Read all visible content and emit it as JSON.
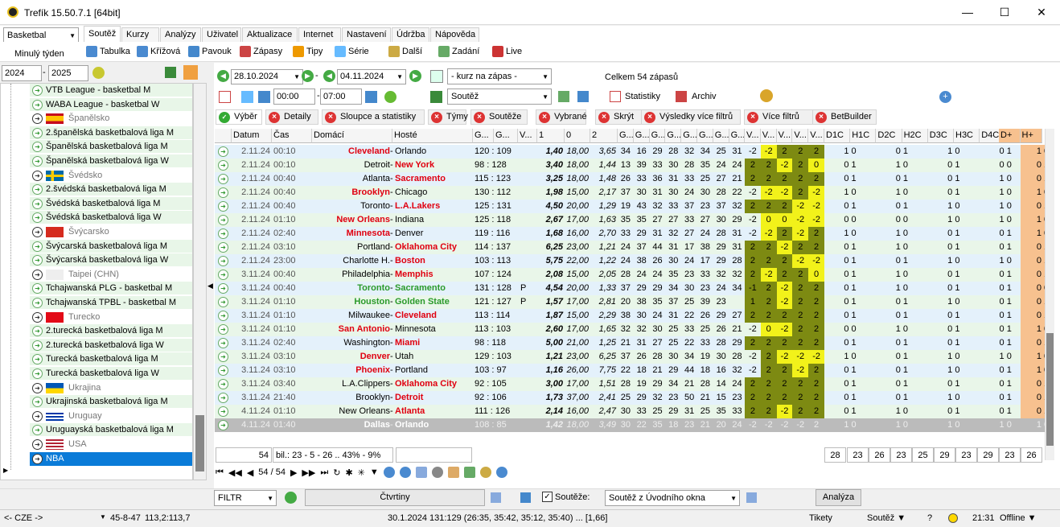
{
  "title": "Trefík 15.50.7.1 [64bit]",
  "sport": "Basketbal",
  "menu_tabs": [
    "Soutěž",
    "Kurzy",
    "Analýzy",
    "Uživatel",
    "Aktualizace",
    "Internet",
    "Nastavení",
    "Údržba",
    "Nápověda"
  ],
  "period": "Minulý týden",
  "toolbar": [
    "Tabulka",
    "Křížová",
    "Pavouk",
    "Zápasy",
    "Tipy",
    "Série",
    "Další",
    "Zadání",
    "Live"
  ],
  "year_from": "2024",
  "year_to": "2025",
  "tree": [
    {
      "t": "league",
      "label": "VTB League - basketbal M"
    },
    {
      "t": "league",
      "label": "WABA League - basketbal W"
    },
    {
      "t": "country",
      "label": "Španělsko",
      "flag": "es"
    },
    {
      "t": "league",
      "label": "2.španělská basketbalová liga M"
    },
    {
      "t": "league",
      "label": "Španělská basketbalová liga M"
    },
    {
      "t": "league",
      "label": "Španělská basketbalová liga W"
    },
    {
      "t": "country",
      "label": "Švédsko",
      "flag": "se"
    },
    {
      "t": "league",
      "label": "2.švédská basketbalová liga M"
    },
    {
      "t": "league",
      "label": "Švédská basketbalová liga M"
    },
    {
      "t": "league",
      "label": "Švédská basketbalová liga W"
    },
    {
      "t": "country",
      "label": "Švýcarsko",
      "flag": "ch"
    },
    {
      "t": "league",
      "label": "Švýcarská basketbalová liga M"
    },
    {
      "t": "league",
      "label": "Švýcarská basketbalová liga W"
    },
    {
      "t": "country",
      "label": "Taipei (CHN)",
      "flag": "tw"
    },
    {
      "t": "league",
      "label": "Tchajwanská PLG - basketbal M"
    },
    {
      "t": "league",
      "label": "Tchajwanská TPBL - basketbal M"
    },
    {
      "t": "country",
      "label": "Turecko",
      "flag": "tr"
    },
    {
      "t": "league",
      "label": "2.turecká basketbalová liga M"
    },
    {
      "t": "league",
      "label": "2.turecká basketbalová liga W"
    },
    {
      "t": "league",
      "label": "Turecká basketbalová liga M"
    },
    {
      "t": "league",
      "label": "Turecká basketbalová liga W"
    },
    {
      "t": "country",
      "label": "Ukrajina",
      "flag": "ua"
    },
    {
      "t": "league",
      "label": "Ukrajinská basketbalová liga M"
    },
    {
      "t": "country",
      "label": "Uruguay",
      "flag": "uy"
    },
    {
      "t": "league",
      "label": "Uruguayská basketbalová liga M"
    },
    {
      "t": "country",
      "label": "USA",
      "flag": "us"
    },
    {
      "t": "sel",
      "label": "NBA"
    }
  ],
  "date_from": "28.10.2024",
  "date_to": "04.11.2024",
  "odds_filter": "- kurz na zápas -",
  "competition_filter": "Soutěž",
  "summary": "Celkem 54 zápasů",
  "time_from": "00:00",
  "time_to": "07:00",
  "stats_label": "Statistiky",
  "archive_label": "Archiv",
  "filter_tabs": [
    "Výběr",
    "Detaily",
    "Sloupce a statistiky",
    "Týmy",
    "Soutěže",
    "Vybrané",
    "Skrýt",
    "Výsledky více filtrů",
    "Více filtrů",
    "BetBuilder"
  ],
  "columns": [
    "Datum",
    "Čas",
    "Domácí",
    "Hosté",
    "G...",
    "G...",
    "V...",
    "1",
    "0",
    "2",
    "G...",
    "G...",
    "G...",
    "G...",
    "G...",
    "G...",
    "G...",
    "G...",
    "V...",
    "V...",
    "V...",
    "V...",
    "V...",
    "D1C",
    "H1C",
    "D2C",
    "H2C",
    "D3C",
    "H3C",
    "D4C",
    "H4C",
    "D+",
    "H+"
  ],
  "rows": [
    {
      "d": "2.11.24",
      "t": "00:10",
      "h": "Cleveland",
      "a": "Orlando",
      "w": "h",
      "s": "120 : 109",
      "p": "",
      "o1": "1,40",
      "o0": "18,00",
      "o2": "3,65",
      "q": [
        "34",
        "16",
        "29",
        "28",
        "32",
        "34",
        "25",
        "31"
      ],
      "v": [
        "-2",
        "-2",
        "2",
        "2",
        "2"
      ],
      "qc": [
        "1 0",
        "0 1",
        "1 0",
        "0 1"
      ],
      "dp": "1 0"
    },
    {
      "d": "2.11.24",
      "t": "00:10",
      "h": "Detroit",
      "a": "New York",
      "w": "a",
      "s": "98 : 128",
      "p": "",
      "o1": "3,40",
      "o0": "18,00",
      "o2": "1,44",
      "q": [
        "13",
        "39",
        "33",
        "30",
        "28",
        "35",
        "24",
        "24"
      ],
      "v": [
        "2",
        "2",
        "-2",
        "2",
        "0"
      ],
      "qc": [
        "0 1",
        "1 0",
        "0 1",
        "0 0"
      ],
      "dp": "0 1"
    },
    {
      "d": "2.11.24",
      "t": "00:40",
      "h": "Atlanta",
      "a": "Sacramento",
      "w": "a",
      "s": "115 : 123",
      "p": "",
      "o1": "3,25",
      "o0": "18,00",
      "o2": "1,48",
      "q": [
        "26",
        "33",
        "36",
        "31",
        "33",
        "25",
        "27",
        "21"
      ],
      "v": [
        "2",
        "2",
        "2",
        "2",
        "2"
      ],
      "qc": [
        "0 1",
        "0 1",
        "0 1",
        "1 0"
      ],
      "dp": "0 1"
    },
    {
      "d": "2.11.24",
      "t": "00:40",
      "h": "Brooklyn",
      "a": "Chicago",
      "w": "h",
      "s": "130 : 112",
      "p": "",
      "o1": "1,98",
      "o0": "15,00",
      "o2": "2,17",
      "q": [
        "37",
        "30",
        "31",
        "30",
        "24",
        "30",
        "28",
        "22"
      ],
      "v": [
        "-2",
        "-2",
        "-2",
        "2",
        "-2"
      ],
      "qc": [
        "1 0",
        "1 0",
        "0 1",
        "1 0"
      ],
      "dp": "1 0"
    },
    {
      "d": "2.11.24",
      "t": "00:40",
      "h": "Toronto",
      "a": "L.A.Lakers",
      "w": "a",
      "s": "125 : 131",
      "p": "",
      "o1": "4,50",
      "o0": "20,00",
      "o2": "1,29",
      "q": [
        "19",
        "43",
        "32",
        "33",
        "37",
        "23",
        "37",
        "32"
      ],
      "v": [
        "2",
        "2",
        "2",
        "-2",
        "-2"
      ],
      "qc": [
        "0 1",
        "0 1",
        "1 0",
        "1 0"
      ],
      "dp": "0 1"
    },
    {
      "d": "2.11.24",
      "t": "01:10",
      "h": "New Orleans",
      "a": "Indiana",
      "w": "h",
      "s": "125 : 118",
      "p": "",
      "o1": "2,67",
      "o0": "17,00",
      "o2": "1,63",
      "q": [
        "35",
        "35",
        "27",
        "27",
        "33",
        "27",
        "30",
        "29"
      ],
      "v": [
        "-2",
        "0",
        "0",
        "-2",
        "-2"
      ],
      "qc": [
        "0 0",
        "0 0",
        "1 0",
        "1 0"
      ],
      "dp": "1 0"
    },
    {
      "d": "2.11.24",
      "t": "02:40",
      "h": "Minnesota",
      "a": "Denver",
      "w": "h",
      "s": "119 : 116",
      "p": "",
      "o1": "1,68",
      "o0": "16,00",
      "o2": "2,70",
      "q": [
        "33",
        "29",
        "31",
        "32",
        "27",
        "24",
        "28",
        "31"
      ],
      "v": [
        "-2",
        "-2",
        "2",
        "-2",
        "2"
      ],
      "qc": [
        "1 0",
        "1 0",
        "0 1",
        "0 1"
      ],
      "dp": "1 0"
    },
    {
      "d": "2.11.24",
      "t": "03:10",
      "h": "Portland",
      "a": "Oklahoma City",
      "w": "a",
      "s": "114 : 137",
      "p": "",
      "o1": "6,25",
      "o0": "23,00",
      "o2": "1,21",
      "q": [
        "24",
        "37",
        "44",
        "31",
        "17",
        "38",
        "29",
        "31"
      ],
      "v": [
        "2",
        "2",
        "-2",
        "2",
        "2"
      ],
      "qc": [
        "0 1",
        "1 0",
        "0 1",
        "0 1"
      ],
      "dp": "0 1"
    },
    {
      "d": "2.11.24",
      "t": "23:00",
      "h": "Charlotte H.",
      "a": "Boston",
      "w": "a",
      "s": "103 : 113",
      "p": "",
      "o1": "5,75",
      "o0": "22,00",
      "o2": "1,22",
      "q": [
        "24",
        "38",
        "26",
        "30",
        "24",
        "17",
        "29",
        "28"
      ],
      "v": [
        "2",
        "2",
        "2",
        "-2",
        "-2"
      ],
      "qc": [
        "0 1",
        "0 1",
        "1 0",
        "1 0"
      ],
      "dp": "0 1"
    },
    {
      "d": "3.11.24",
      "t": "00:40",
      "h": "Philadelphia",
      "a": "Memphis",
      "w": "a",
      "s": "107 : 124",
      "p": "",
      "o1": "2,08",
      "o0": "15,00",
      "o2": "2,05",
      "q": [
        "28",
        "24",
        "24",
        "35",
        "23",
        "33",
        "32",
        "32"
      ],
      "v": [
        "2",
        "-2",
        "2",
        "2",
        "0"
      ],
      "qc": [
        "0 1",
        "1 0",
        "0 1",
        "0 1"
      ],
      "dp": "0 1"
    },
    {
      "d": "3.11.24",
      "t": "00:40",
      "h": "Toronto",
      "a": "Sacramento",
      "w": "g",
      "s": "131 : 128",
      "p": "P",
      "o1": "4,54",
      "o0": "20,00",
      "o2": "1,33",
      "q": [
        "37",
        "29",
        "29",
        "34",
        "30",
        "23",
        "24",
        "34"
      ],
      "v": [
        "-1",
        "2",
        "-2",
        "2",
        "2"
      ],
      "qc": [
        "0 1",
        "1 0",
        "0 1",
        "0 1"
      ],
      "dp": "0 0"
    },
    {
      "d": "3.11.24",
      "t": "01:10",
      "h": "Houston",
      "a": "Golden State",
      "w": "g",
      "s": "121 : 127",
      "p": "P",
      "o1": "1,57",
      "o0": "17,00",
      "o2": "2,81",
      "q": [
        "20",
        "38",
        "35",
        "37",
        "25",
        "39",
        "23"
      ],
      "v": [
        "1",
        "2",
        "-2",
        "2",
        "2"
      ],
      "qc": [
        "0 1",
        "0 1",
        "1 0",
        "0 1"
      ],
      "dp": "0 1"
    },
    {
      "d": "3.11.24",
      "t": "01:10",
      "h": "Milwaukee",
      "a": "Cleveland",
      "w": "a",
      "s": "113 : 114",
      "p": "",
      "o1": "1,87",
      "o0": "15,00",
      "o2": "2,29",
      "q": [
        "38",
        "30",
        "24",
        "31",
        "22",
        "26",
        "29",
        "27"
      ],
      "v": [
        "2",
        "2",
        "2",
        "2",
        "2"
      ],
      "qc": [
        "0 1",
        "0 1",
        "0 1",
        "0 1"
      ],
      "dp": "0 1"
    },
    {
      "d": "3.11.24",
      "t": "01:10",
      "h": "San Antonio",
      "a": "Minnesota",
      "w": "h",
      "s": "113 : 103",
      "p": "",
      "o1": "2,60",
      "o0": "17,00",
      "o2": "1,65",
      "q": [
        "32",
        "32",
        "30",
        "25",
        "33",
        "25",
        "26",
        "21"
      ],
      "v": [
        "-2",
        "0",
        "-2",
        "2",
        "2"
      ],
      "qc": [
        "0 0",
        "1 0",
        "0 1",
        "0 1"
      ],
      "dp": "1 0"
    },
    {
      "d": "3.11.24",
      "t": "02:40",
      "h": "Washington",
      "a": "Miami",
      "w": "a",
      "s": "98 : 118",
      "p": "",
      "o1": "5,00",
      "o0": "21,00",
      "o2": "1,25",
      "q": [
        "21",
        "31",
        "27",
        "25",
        "22",
        "33",
        "28",
        "29"
      ],
      "v": [
        "2",
        "2",
        "2",
        "2",
        "2"
      ],
      "qc": [
        "0 1",
        "0 1",
        "0 1",
        "0 1"
      ],
      "dp": "0 1"
    },
    {
      "d": "3.11.24",
      "t": "03:10",
      "h": "Denver",
      "a": "Utah",
      "w": "h",
      "s": "129 : 103",
      "p": "",
      "o1": "1,21",
      "o0": "23,00",
      "o2": "6,25",
      "q": [
        "37",
        "26",
        "28",
        "30",
        "34",
        "19",
        "30",
        "28"
      ],
      "v": [
        "-2",
        "2",
        "-2",
        "-2",
        "-2"
      ],
      "qc": [
        "1 0",
        "0 1",
        "1 0",
        "1 0"
      ],
      "dp": "1 0"
    },
    {
      "d": "3.11.24",
      "t": "03:10",
      "h": "Phoenix",
      "a": "Portland",
      "w": "h",
      "s": "103 : 97",
      "p": "",
      "o1": "1,16",
      "o0": "26,00",
      "o2": "7,75",
      "q": [
        "22",
        "18",
        "21",
        "29",
        "44",
        "18",
        "16",
        "32"
      ],
      "v": [
        "-2",
        "2",
        "2",
        "-2",
        "2"
      ],
      "qc": [
        "0 1",
        "0 1",
        "1 0",
        "0 1"
      ],
      "dp": "1 0"
    },
    {
      "d": "3.11.24",
      "t": "03:40",
      "h": "L.A.Clippers",
      "a": "Oklahoma City",
      "w": "a",
      "s": "92 : 105",
      "p": "",
      "o1": "3,00",
      "o0": "17,00",
      "o2": "1,51",
      "q": [
        "28",
        "19",
        "29",
        "34",
        "21",
        "28",
        "14",
        "24"
      ],
      "v": [
        "2",
        "2",
        "2",
        "2",
        "2"
      ],
      "qc": [
        "0 1",
        "0 1",
        "0 1",
        "0 1"
      ],
      "dp": "0 1"
    },
    {
      "d": "3.11.24",
      "t": "21:40",
      "h": "Brooklyn",
      "a": "Detroit",
      "w": "a",
      "s": "92 : 106",
      "p": "",
      "o1": "1,73",
      "o0": "37,00",
      "o2": "2,41",
      "q": [
        "25",
        "29",
        "32",
        "23",
        "50",
        "21",
        "15",
        "23"
      ],
      "v": [
        "2",
        "2",
        "2",
        "2",
        "2"
      ],
      "qc": [
        "0 1",
        "0 1",
        "1 0",
        "0 1"
      ],
      "dp": "0 1"
    },
    {
      "d": "4.11.24",
      "t": "01:10",
      "h": "New Orleans",
      "a": "Atlanta",
      "w": "a",
      "s": "111 : 126",
      "p": "",
      "o1": "2,14",
      "o0": "16,00",
      "o2": "2,47",
      "q": [
        "30",
        "33",
        "25",
        "29",
        "31",
        "25",
        "35",
        "33"
      ],
      "v": [
        "2",
        "2",
        "-2",
        "2",
        "2"
      ],
      "qc": [
        "0 1",
        "1 0",
        "0 1",
        "0 1"
      ],
      "dp": "0 1"
    },
    {
      "d": "4.11.24",
      "t": "01:40",
      "h": "Dallas",
      "a": "Orlando",
      "w": "sel",
      "s": "108 : 85",
      "p": "",
      "o1": "1,42",
      "o0": "18,00",
      "o2": "3,49",
      "q": [
        "30",
        "22",
        "35",
        "18",
        "23",
        "21",
        "20",
        "24"
      ],
      "v": [
        "-2",
        "-2",
        "-2",
        "-2",
        "2"
      ],
      "qc": [
        "1 0",
        "1 0",
        "1 0",
        "1 0"
      ],
      "dp": "1 0"
    }
  ],
  "sum_count": "54",
  "sum_balance": "bil.: 23 - 5 - 26 .. 43% - 9%",
  "sum_cols": [
    "28",
    "23",
    "26",
    "23",
    "25",
    "29",
    "23",
    "29",
    "23",
    "26"
  ],
  "nav_pos": "54 / 54",
  "filter_label": "FILTR",
  "quarters_label": "Čtvrtiny",
  "souteze_label": "Soutěže:",
  "souteze_source": "Soutěž z Úvodního okna",
  "analyza_label": "Analýza",
  "status": {
    "lang": "<- CZE ->",
    "rec": "45-8-47",
    "score": "113,2:113,7",
    "match": "30.1.2024 131:129 (26:35, 35:42, 35:12, 35:40) ... [1,66]",
    "tikety": "Tikety",
    "soutez": "Soutěž ▼",
    "q": "?",
    "time": "21:31",
    "online": "Offline ▼"
  }
}
